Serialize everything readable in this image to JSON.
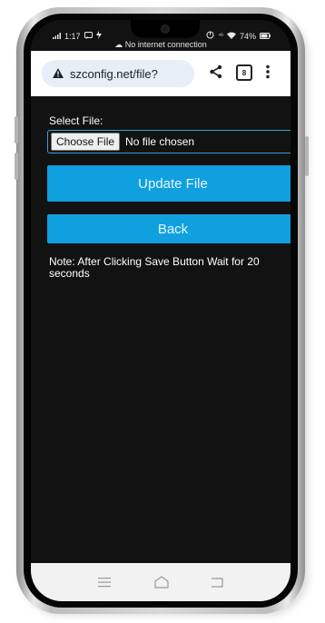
{
  "status_bar": {
    "time": "1:17",
    "signal_icon": "signal-icon",
    "battery_text": "74%",
    "connection_message": "No internet connection"
  },
  "browser": {
    "url": "szconfig.net/file?",
    "tab_count": "8",
    "warning_icon": "warning-icon",
    "share_icon": "share-icon",
    "menu_icon": "more-vert-icon"
  },
  "page": {
    "select_label": "Select File:",
    "choose_file_label": "Choose File",
    "no_file_text": "No file chosen",
    "update_button_label": "Update File",
    "back_button_label": "Back",
    "note_text": "Note: After Clicking Save Button Wait for 20 seconds"
  },
  "nav": {
    "recents_icon": "recents-icon",
    "home_icon": "home-icon",
    "back_icon": "back-icon"
  },
  "colors": {
    "button_blue": "#10a0e0",
    "screen_bg": "#121212"
  }
}
